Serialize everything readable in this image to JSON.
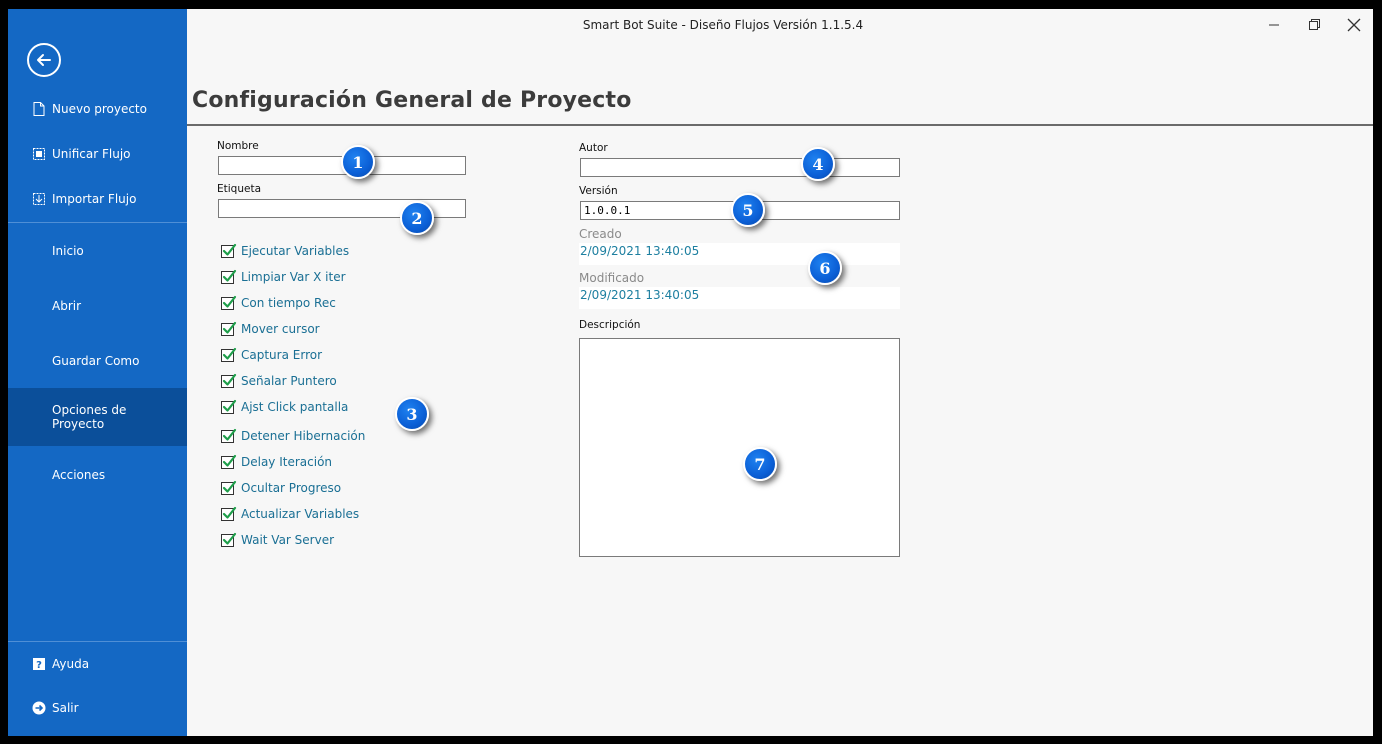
{
  "window": {
    "title": "Smart Bot Suite - Diseño Flujos Versión 1.1.5.4"
  },
  "sidebar": {
    "top_items": [
      {
        "label": "Nuevo proyecto",
        "icon": "new-file-icon"
      },
      {
        "label": "Unificar Flujo",
        "icon": "merge-flow-icon"
      },
      {
        "label": "Importar Flujo",
        "icon": "import-flow-icon"
      }
    ],
    "items": [
      {
        "label": "Inicio"
      },
      {
        "label": "Abrir"
      },
      {
        "label": "Guardar Como"
      },
      {
        "label": "Opciones de Proyecto",
        "active": true
      },
      {
        "label": "Acciones"
      }
    ],
    "bottom_items": [
      {
        "label": "Ayuda",
        "icon": "help-icon"
      },
      {
        "label": "Salir",
        "icon": "exit-icon"
      }
    ]
  },
  "page": {
    "title": "Configuración General de Proyecto"
  },
  "form": {
    "nombre": {
      "label": "Nombre",
      "value": ""
    },
    "etiqueta": {
      "label": "Etiqueta",
      "value": ""
    },
    "autor": {
      "label": "Autor",
      "value": ""
    },
    "version": {
      "label": "Versión",
      "value": "1.0.0.1"
    },
    "creado": {
      "label": "Creado",
      "value": "2/09/2021 13:40:05"
    },
    "modificado": {
      "label": "Modificado",
      "value": "2/09/2021 13:40:05"
    },
    "descripcion": {
      "label": "Descripción",
      "value": ""
    }
  },
  "options": [
    {
      "label": "Ejecutar Variables",
      "checked": true
    },
    {
      "label": "Limpiar Var X iter",
      "checked": true
    },
    {
      "label": "Con tiempo Rec",
      "checked": true
    },
    {
      "label": "Mover cursor",
      "checked": true
    },
    {
      "label": "Captura Error",
      "checked": true
    },
    {
      "label": "Señalar Puntero",
      "checked": true
    },
    {
      "label": "Ajst Click pantalla",
      "checked": true
    },
    {
      "label": "Detener Hibernación",
      "checked": true
    },
    {
      "label": "Delay Iteración",
      "checked": true
    },
    {
      "label": "Ocultar Progreso",
      "checked": true
    },
    {
      "label": "Actualizar Variables",
      "checked": true
    },
    {
      "label": "Wait Var Server",
      "checked": true
    }
  ],
  "callouts": [
    "1",
    "2",
    "3",
    "4",
    "5",
    "6",
    "7"
  ],
  "colors": {
    "sidebar": "#1468c4",
    "sidebar_active": "#0b4f9a",
    "option_text": "#1a6f94",
    "check_mark": "#1e9e4a",
    "callout": "#0b5fd6"
  }
}
